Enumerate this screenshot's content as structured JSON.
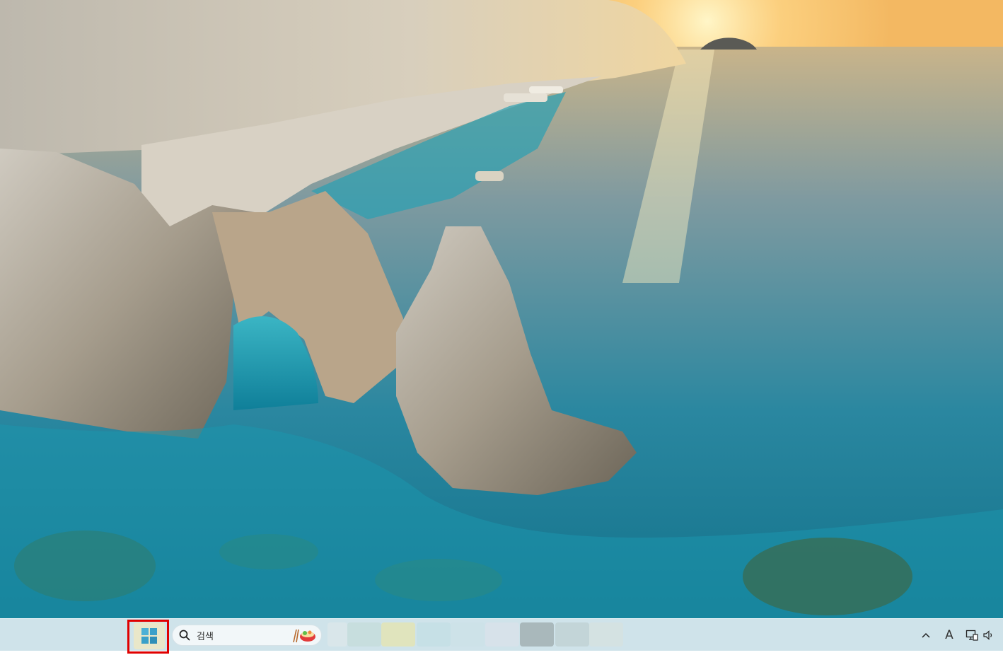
{
  "taskbar": {
    "search": {
      "label": "검색"
    },
    "tray": {
      "ime_label": "A"
    }
  },
  "colors": {
    "start_highlight": "#e00000",
    "taskbar_bg": "#cfe3ea"
  },
  "icons": [
    "windows-start-icon",
    "search-icon",
    "search-highlight-icon",
    "chevron-up-icon",
    "network-icon",
    "volume-icon"
  ]
}
